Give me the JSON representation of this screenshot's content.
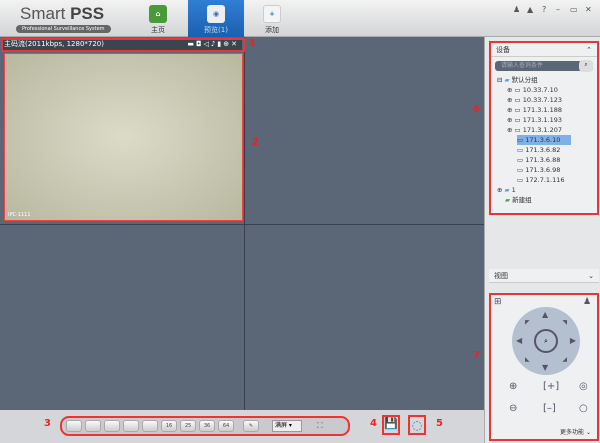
{
  "app": {
    "title_light": "Smart ",
    "title_bold": "PSS",
    "subtitle": "Professional Surveillance System"
  },
  "tabs": [
    {
      "label": "主页",
      "icon": "home-icon"
    },
    {
      "label": "预览(1)",
      "icon": "camera-icon"
    },
    {
      "label": "添加",
      "icon": "plus-icon"
    }
  ],
  "window_controls": [
    "user-icon",
    "lock-icon",
    "help-icon",
    "minimize-icon",
    "maximize-icon",
    "close-icon"
  ],
  "video": {
    "stream_info": "主码流(2011kbps, 1280*720)",
    "overlay_text": "IPC-1111",
    "icons": [
      "record-icon",
      "snapshot-icon",
      "audio-icon",
      "talk-icon",
      "manual-icon",
      "zoom-icon",
      "close-icon"
    ]
  },
  "toolbar": {
    "layouts": [
      "",
      "",
      "",
      "",
      "",
      "16",
      "25",
      "36",
      "64"
    ],
    "stream_select": "满屏",
    "save_icon": "save-icon",
    "refresh_icon": "refresh-icon"
  },
  "devices": {
    "title": "设备",
    "search_placeholder": "请输入查询条件",
    "group": "默认分组",
    "items": [
      "10.33.7.10",
      "10.33.7.123",
      "171.3.1.188",
      "171.3.1.193",
      "171.3.1.207",
      "171.3.6.10",
      "171.3.6.82",
      "171.3.6.88",
      "171.3.6.98",
      "172.7.1.116"
    ],
    "other_group": "1",
    "new_group": "新建组"
  },
  "view": {
    "title": "视图"
  },
  "ptz": {
    "more": "更多功能"
  },
  "annotations": [
    "1",
    "2",
    "3",
    "4",
    "5",
    "6",
    "7"
  ]
}
